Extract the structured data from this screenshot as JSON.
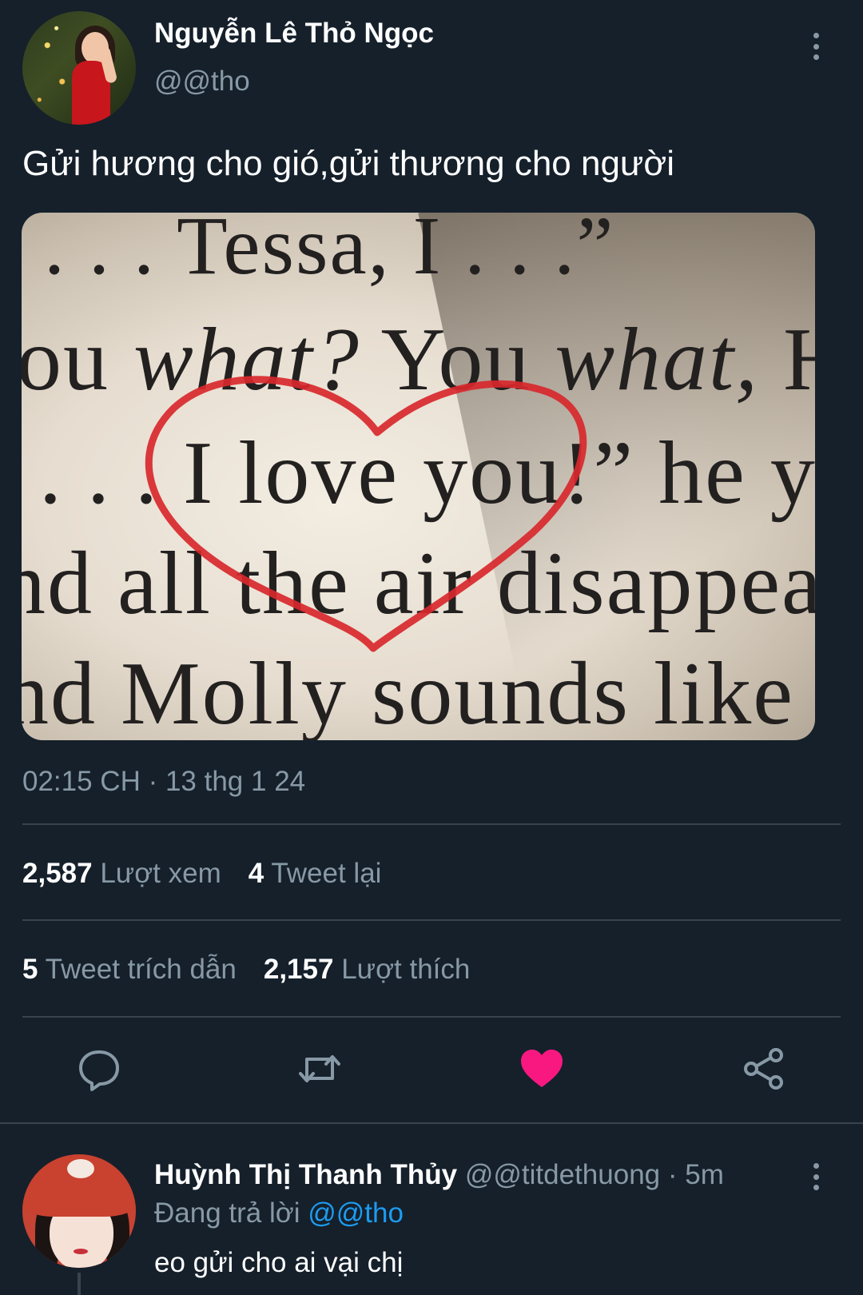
{
  "tweet": {
    "author_name": "Nguyễn Lê Thỏ Ngọc",
    "author_handle": "@@tho",
    "text": "Gửi hương cho gió,gửi thương cho người",
    "image_text": {
      "line1_a": ". . . ",
      "line1_b": "Tessa, I . . .",
      "line1_c": "”",
      "line2_a": "ou ",
      "line2_b": "what?",
      "line2_c": " You ",
      "line2_d": "what,",
      "line2_e": " Ha",
      "line3_a": ". . . I love you!” he yell",
      "line4_a": "nd all the air disappear",
      "line5_a": "nd Molly sounds like sl"
    },
    "timestamp": "02:15 CH · 13 thg 1 24",
    "stats": {
      "views_count": "2,587",
      "views_label": "Lượt xem",
      "retweets_count": "4",
      "retweets_label": "Tweet lại",
      "quotes_count": "5",
      "quotes_label": "Tweet trích dẫn",
      "likes_count": "2,157",
      "likes_label": "Lượt thích"
    },
    "actions": {
      "reply_icon": "reply-icon",
      "retweet_icon": "retweet-icon",
      "like_icon": "heart-icon",
      "share_icon": "share-icon",
      "liked": true,
      "like_color": "#f91880"
    }
  },
  "reply": {
    "author_name": "Huỳnh Thị Thanh Thủy",
    "author_handle": "@@titdethuong",
    "time": " · 5m",
    "replying_to_label": "Đang trả lời ",
    "replying_to_handle": "@@tho",
    "text": "eo gửi cho ai vại chị"
  },
  "colors": {
    "background": "#15202b",
    "secondary_text": "#8899a6",
    "link": "#1d9bf0",
    "divider": "#38444d"
  }
}
